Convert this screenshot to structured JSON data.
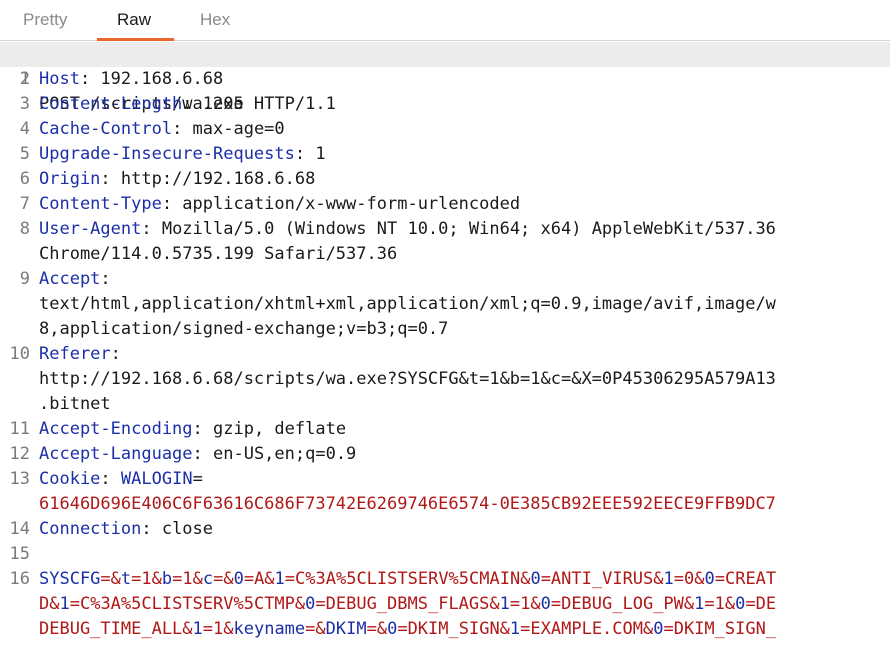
{
  "tabs": {
    "pretty": "Pretty",
    "raw": "Raw",
    "hex": "Hex"
  },
  "request": {
    "request_line": "POST /scripts/wa.exe HTTP/1.1",
    "headers": [
      {
        "num": "2",
        "name": "Host",
        "value": " 192.168.6.68"
      },
      {
        "num": "3",
        "name": "Content-Length",
        "value": " 1205"
      },
      {
        "num": "4",
        "name": "Cache-Control",
        "value": " max-age=0"
      },
      {
        "num": "5",
        "name": "Upgrade-Insecure-Requests",
        "value": " 1"
      },
      {
        "num": "6",
        "name": "Origin",
        "value": " http://192.168.6.68"
      },
      {
        "num": "7",
        "name": "Content-Type",
        "value": " application/x-www-form-urlencoded"
      },
      {
        "num": "8",
        "name": "User-Agent",
        "value": " Mozilla/5.0 (Windows NT 10.0; Win64; x64) AppleWebKit/537.36",
        "cont": [
          "Chrome/114.0.5735.199 Safari/537.36"
        ]
      },
      {
        "num": "9",
        "name": "Accept",
        "value": "",
        "cont": [
          "text/html,application/xhtml+xml,application/xml;q=0.9,image/avif,image/w",
          "8,application/signed-exchange;v=b3;q=0.7"
        ]
      },
      {
        "num": "10",
        "name": "Referer",
        "value": "",
        "cont": [
          "http://192.168.6.68/scripts/wa.exe?SYSCFG&t=1&b=1&c=&X=0P45306295A579A13",
          ".bitnet"
        ]
      },
      {
        "num": "11",
        "name": "Accept-Encoding",
        "value": " gzip, deflate"
      },
      {
        "num": "12",
        "name": "Accept-Language",
        "value": " en-US,en;q=0.9"
      }
    ],
    "cookie": {
      "num": "13",
      "name": "Cookie",
      "cookie_name": "WALOGIN",
      "cookie_value": "61646D696E406C6F63616C686F73742E6269746E6574-0E385CB92EEE592EECE9FFB9DC7"
    },
    "connection": {
      "num": "14",
      "name": "Connection",
      "value": " close"
    },
    "blank_num": "15",
    "body_num": "16",
    "body_lines": [
      [
        [
          "b",
          "SYSCFG"
        ],
        [
          "r",
          "=&"
        ],
        [
          "b",
          "t"
        ],
        [
          "r",
          "=1&"
        ],
        [
          "b",
          "b"
        ],
        [
          "r",
          "=1&"
        ],
        [
          "b",
          "c"
        ],
        [
          "r",
          "=&"
        ],
        [
          "b",
          "0"
        ],
        [
          "r",
          "=A&"
        ],
        [
          "b",
          "1"
        ],
        [
          "r",
          "=C%3A%5CLISTSERV%5CMAIN&"
        ],
        [
          "b",
          "0"
        ],
        [
          "r",
          "=ANTI_VIRUS&"
        ],
        [
          "b",
          "1"
        ],
        [
          "r",
          "=0&"
        ],
        [
          "b",
          "0"
        ],
        [
          "r",
          "=CREAT"
        ]
      ],
      [
        [
          "r",
          "D&"
        ],
        [
          "b",
          "1"
        ],
        [
          "r",
          "=C%3A%5CLISTSERV%5CTMP&"
        ],
        [
          "b",
          "0"
        ],
        [
          "r",
          "=DEBUG_DBMS_FLAGS&"
        ],
        [
          "b",
          "1"
        ],
        [
          "r",
          "=1&"
        ],
        [
          "b",
          "0"
        ],
        [
          "r",
          "=DEBUG_LOG_PW&"
        ],
        [
          "b",
          "1"
        ],
        [
          "r",
          "=1&"
        ],
        [
          "b",
          "0"
        ],
        [
          "r",
          "=DE"
        ]
      ],
      [
        [
          "r",
          "DEBUG_TIME_ALL&"
        ],
        [
          "b",
          "1"
        ],
        [
          "r",
          "=1&"
        ],
        [
          "b",
          "keyname"
        ],
        [
          "r",
          "=&"
        ],
        [
          "b",
          "DKIM"
        ],
        [
          "r",
          "=&"
        ],
        [
          "b",
          "0"
        ],
        [
          "r",
          "=DKIM_SIGN&"
        ],
        [
          "b",
          "1"
        ],
        [
          "r",
          "=EXAMPLE.COM&"
        ],
        [
          "b",
          "0"
        ],
        [
          "r",
          "=DKIM_SIGN_"
        ]
      ]
    ]
  }
}
